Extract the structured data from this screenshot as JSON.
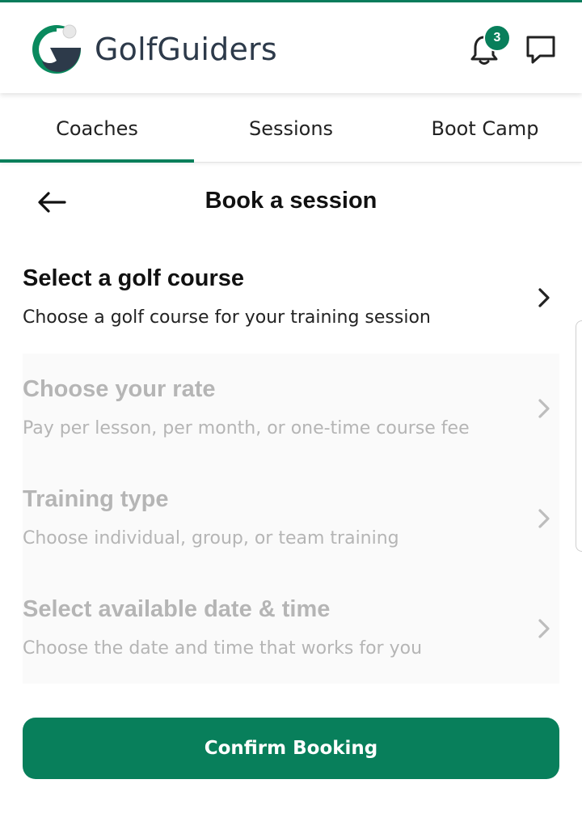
{
  "app": {
    "brand_name": "GolfGuiders",
    "accent_color": "#087f5b",
    "notification_count": "3"
  },
  "tabs": [
    {
      "label": "Coaches",
      "active": true
    },
    {
      "label": "Sessions",
      "active": false
    },
    {
      "label": "Boot Camp",
      "active": false
    }
  ],
  "page": {
    "title": "Book a session"
  },
  "steps": [
    {
      "title": "Select a golf course",
      "subtitle": "Choose a golf course for your training session",
      "enabled": true
    },
    {
      "title": "Choose your rate",
      "subtitle": "Pay per lesson, per month, or one-time course fee",
      "enabled": false
    },
    {
      "title": "Training type",
      "subtitle": "Choose individual, group, or team training",
      "enabled": false
    },
    {
      "title": "Select available date & time",
      "subtitle": "Choose the date and time that works for you",
      "enabled": false
    }
  ],
  "actions": {
    "confirm_label": "Confirm Booking"
  },
  "icons": {
    "logo": "golfguiders-logo",
    "bell": "bell-icon",
    "chat": "chat-icon",
    "back": "back-arrow-icon",
    "chevron": "chevron-right-icon"
  }
}
